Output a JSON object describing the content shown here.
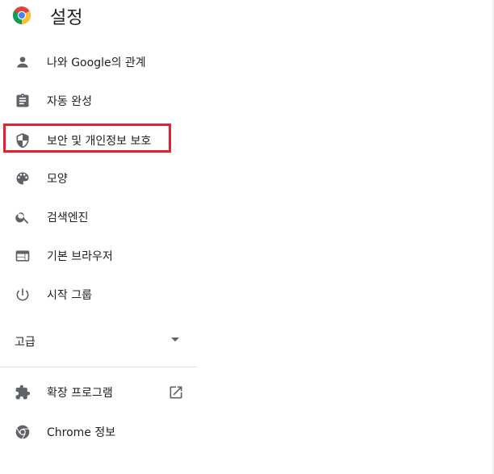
{
  "header": {
    "title": "설정"
  },
  "nav": {
    "items": [
      {
        "label": "나와 Google의 관계",
        "icon": "person-icon"
      },
      {
        "label": "자동 완성",
        "icon": "clipboard-icon"
      },
      {
        "label": "보안 및 개인정보 보호",
        "icon": "shield-icon"
      },
      {
        "label": "모양",
        "icon": "palette-icon"
      },
      {
        "label": "검색엔진",
        "icon": "search-icon"
      },
      {
        "label": "기본 브라우저",
        "icon": "browser-icon"
      },
      {
        "label": "시작 그룹",
        "icon": "power-icon"
      }
    ],
    "advanced_label": "고급",
    "bottom_items": [
      {
        "label": "확장 프로그램",
        "icon": "puzzle-icon"
      },
      {
        "label": "Chrome 정보",
        "icon": "chrome-icon"
      }
    ]
  },
  "colors": {
    "highlight": "#e8202b",
    "icon": "#5f6368"
  }
}
